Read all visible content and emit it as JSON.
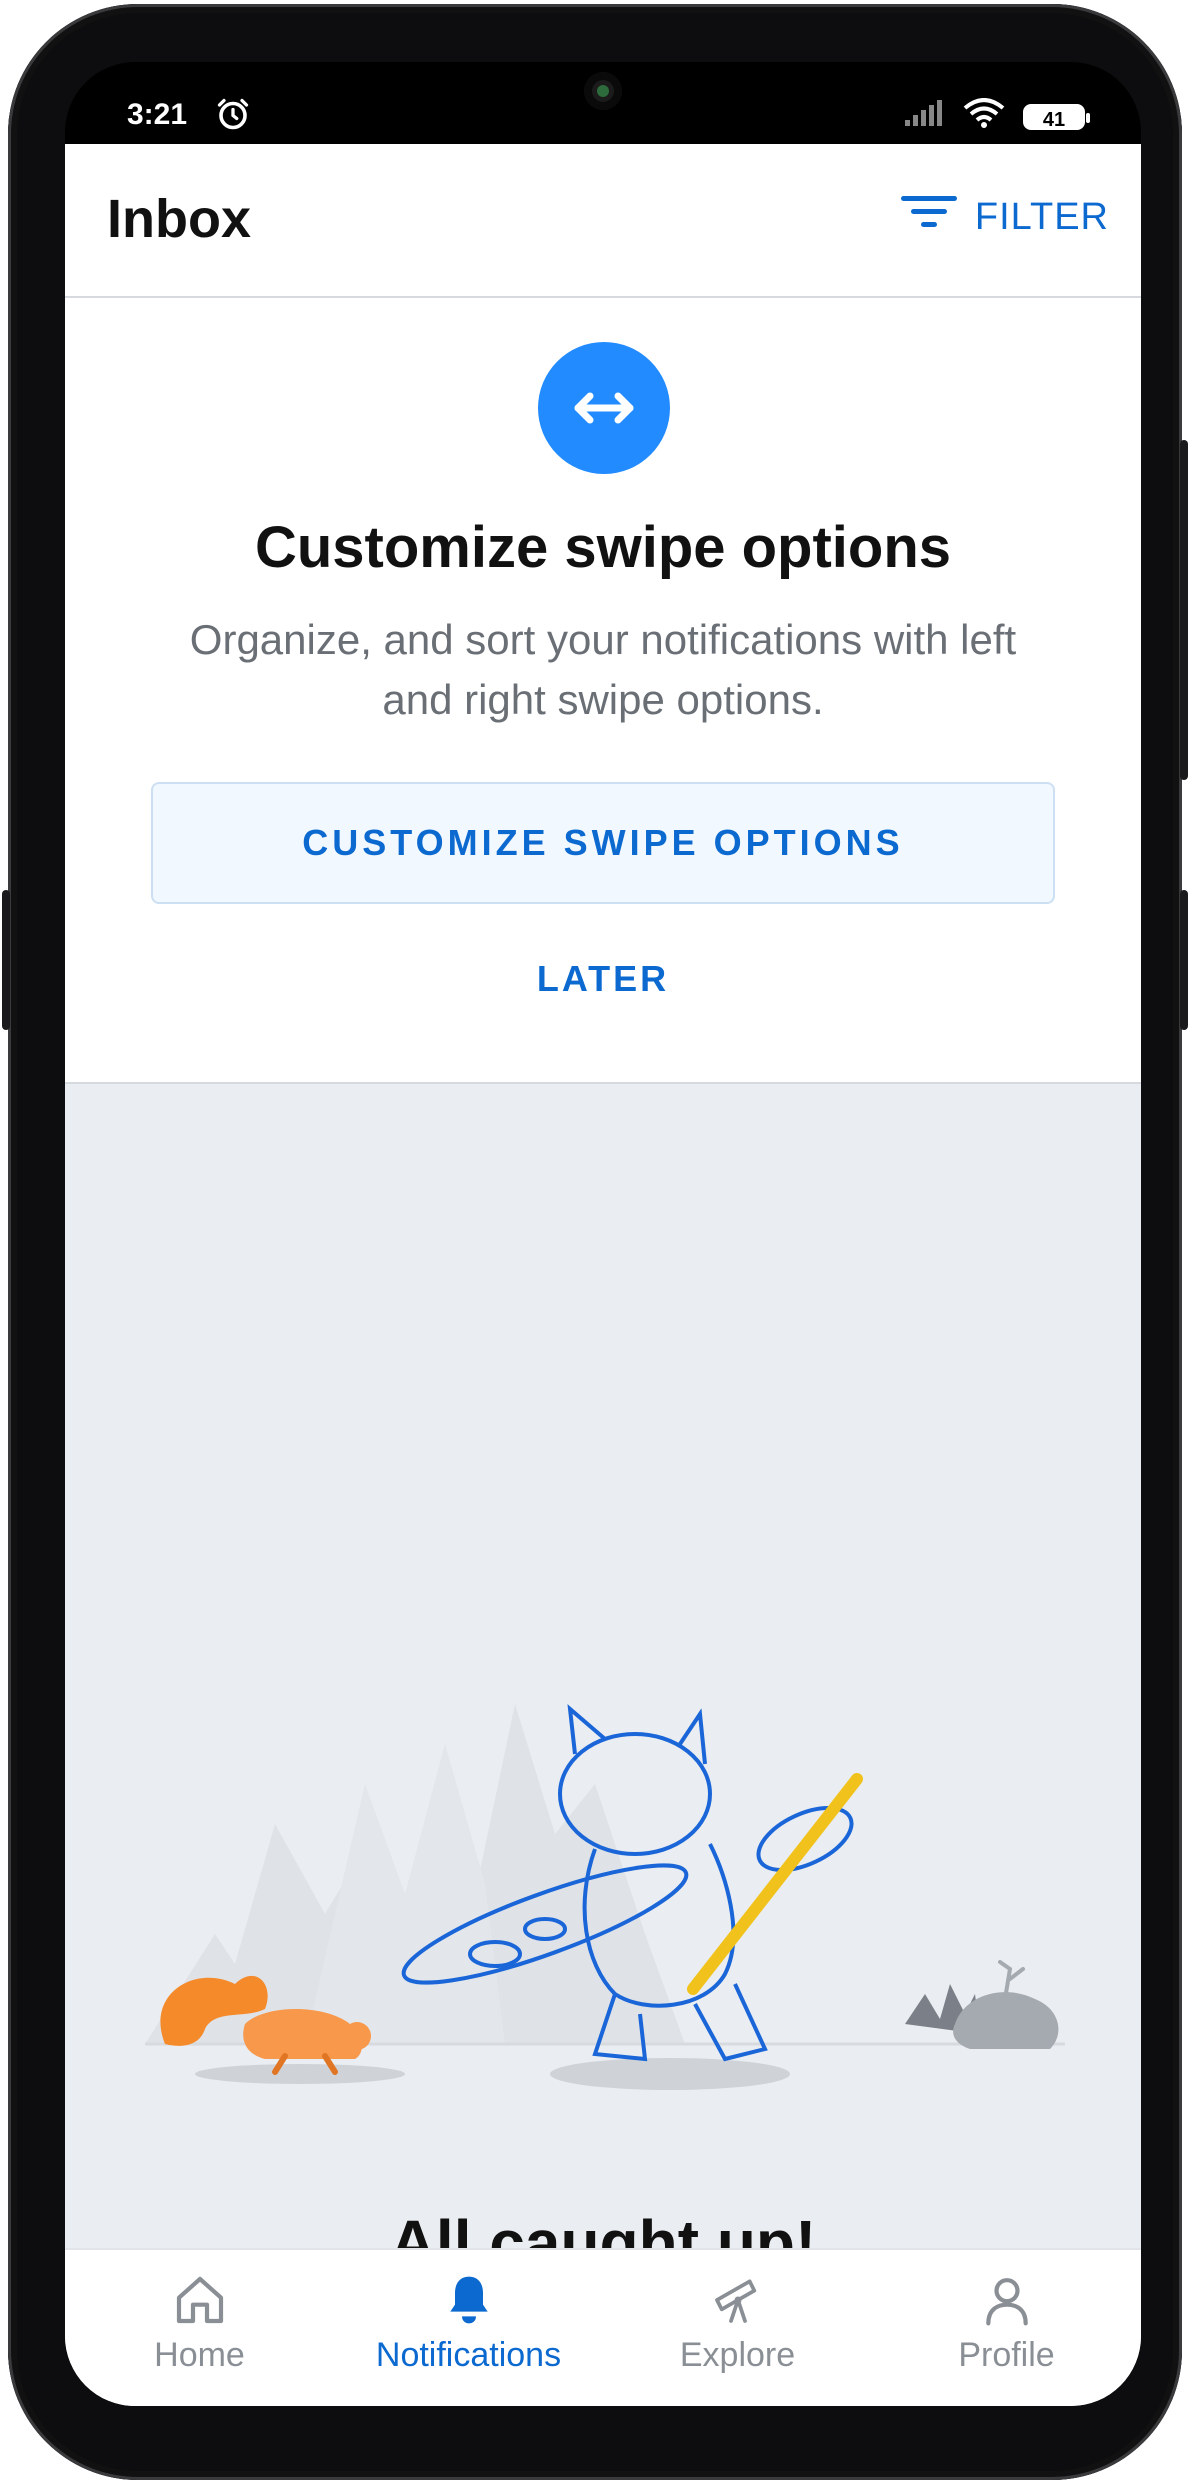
{
  "status_bar": {
    "time": "3:21",
    "battery": "41"
  },
  "header": {
    "title": "Inbox",
    "filter_label": "FILTER"
  },
  "swipe_card": {
    "icon": "swap-arrows-icon",
    "title": "Customize swipe options",
    "description": "Organize, and sort your notifications with left and right swipe options.",
    "primary_button": "CUSTOMIZE SWIPE OPTIONS",
    "secondary_button": "LATER"
  },
  "empty_state": {
    "title": "All caught up!"
  },
  "tab_bar": {
    "tabs": [
      {
        "label": "Home",
        "icon": "home-icon",
        "active": false
      },
      {
        "label": "Notifications",
        "icon": "bell-icon",
        "active": true
      },
      {
        "label": "Explore",
        "icon": "telescope-icon",
        "active": false
      },
      {
        "label": "Profile",
        "icon": "person-icon",
        "active": false
      }
    ]
  },
  "colors": {
    "accent": "#0b69d0",
    "swipe_circle": "#218bff",
    "background": "#eaedf1"
  }
}
